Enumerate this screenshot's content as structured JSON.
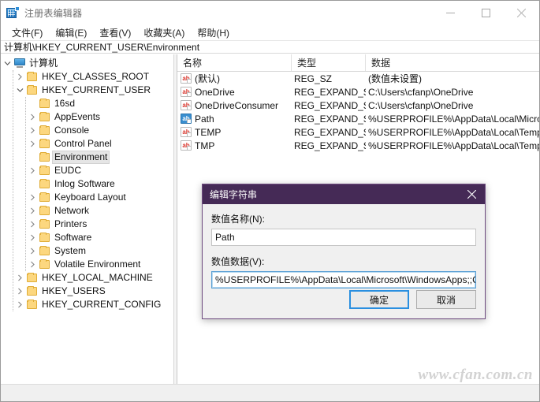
{
  "window": {
    "title": "注册表编辑器",
    "icon": "regedit-icon",
    "minimize_label": "最小化",
    "maximize_label": "最大化",
    "close_label": "关闭"
  },
  "menubar": {
    "items": [
      {
        "label": "文件(F)",
        "name": "menu-file"
      },
      {
        "label": "编辑(E)",
        "name": "menu-edit"
      },
      {
        "label": "查看(V)",
        "name": "menu-view"
      },
      {
        "label": "收藏夹(A)",
        "name": "menu-favorites"
      },
      {
        "label": "帮助(H)",
        "name": "menu-help"
      }
    ]
  },
  "address": {
    "path": "计算机\\HKEY_CURRENT_USER\\Environment"
  },
  "tree": {
    "items": [
      {
        "label": "计算机",
        "depth": 0,
        "chevron": "down",
        "icon": "computer-icon",
        "selected": false
      },
      {
        "label": "HKEY_CLASSES_ROOT",
        "depth": 1,
        "chevron": "right",
        "icon": "folder-icon",
        "selected": false
      },
      {
        "label": "HKEY_CURRENT_USER",
        "depth": 1,
        "chevron": "down",
        "icon": "folder-icon",
        "selected": false
      },
      {
        "label": "16sd",
        "depth": 2,
        "chevron": "none",
        "icon": "folder-icon",
        "selected": false
      },
      {
        "label": "AppEvents",
        "depth": 2,
        "chevron": "right",
        "icon": "folder-icon",
        "selected": false
      },
      {
        "label": "Console",
        "depth": 2,
        "chevron": "right",
        "icon": "folder-icon",
        "selected": false
      },
      {
        "label": "Control Panel",
        "depth": 2,
        "chevron": "right",
        "icon": "folder-icon",
        "selected": false
      },
      {
        "label": "Environment",
        "depth": 2,
        "chevron": "none",
        "icon": "folder-icon",
        "selected": true
      },
      {
        "label": "EUDC",
        "depth": 2,
        "chevron": "right",
        "icon": "folder-icon",
        "selected": false
      },
      {
        "label": "Inlog Software",
        "depth": 2,
        "chevron": "none",
        "icon": "folder-icon",
        "selected": false
      },
      {
        "label": "Keyboard Layout",
        "depth": 2,
        "chevron": "right",
        "icon": "folder-icon",
        "selected": false
      },
      {
        "label": "Network",
        "depth": 2,
        "chevron": "right",
        "icon": "folder-icon",
        "selected": false
      },
      {
        "label": "Printers",
        "depth": 2,
        "chevron": "right",
        "icon": "folder-icon",
        "selected": false
      },
      {
        "label": "Software",
        "depth": 2,
        "chevron": "right",
        "icon": "folder-icon",
        "selected": false
      },
      {
        "label": "System",
        "depth": 2,
        "chevron": "right",
        "icon": "folder-icon",
        "selected": false
      },
      {
        "label": "Volatile Environment",
        "depth": 2,
        "chevron": "right",
        "icon": "folder-icon",
        "selected": false
      },
      {
        "label": "HKEY_LOCAL_MACHINE",
        "depth": 1,
        "chevron": "right",
        "icon": "folder-icon",
        "selected": false
      },
      {
        "label": "HKEY_USERS",
        "depth": 1,
        "chevron": "right",
        "icon": "folder-icon",
        "selected": false
      },
      {
        "label": "HKEY_CURRENT_CONFIG",
        "depth": 1,
        "chevron": "right",
        "icon": "folder-icon",
        "selected": false
      }
    ]
  },
  "listview": {
    "columns": [
      {
        "label": "名称",
        "name": "column-name"
      },
      {
        "label": "类型",
        "name": "column-type"
      },
      {
        "label": "数据",
        "name": "column-data"
      }
    ],
    "rows": [
      {
        "name": "(默认)",
        "type": "REG_SZ",
        "data": "(数值未设置)",
        "icon": "string-value-icon",
        "selected": false
      },
      {
        "name": "OneDrive",
        "type": "REG_EXPAND_SZ",
        "data": "C:\\Users\\cfanp\\OneDrive",
        "icon": "string-value-icon",
        "selected": false
      },
      {
        "name": "OneDriveConsumer",
        "type": "REG_EXPAND_SZ",
        "data": "C:\\Users\\cfanp\\OneDrive",
        "icon": "string-value-icon",
        "selected": false
      },
      {
        "name": "Path",
        "type": "REG_EXPAND_SZ",
        "data": "%USERPROFILE%\\AppData\\Local\\Microsoft\\..",
        "icon": "string-value-icon",
        "selected": true
      },
      {
        "name": "TEMP",
        "type": "REG_EXPAND_SZ",
        "data": "%USERPROFILE%\\AppData\\Local\\Temp",
        "icon": "string-value-icon",
        "selected": false
      },
      {
        "name": "TMP",
        "type": "REG_EXPAND_SZ",
        "data": "%USERPROFILE%\\AppData\\Local\\Temp",
        "icon": "string-value-icon",
        "selected": false
      }
    ],
    "icon_text": "ab"
  },
  "dialog": {
    "title": "编辑字符串",
    "close_label": "✕",
    "name_label": "数值名称(N):",
    "name_value": "Path",
    "data_label": "数值数据(V):",
    "data_value_before_caret": "%USERPROFILE%\\AppData",
    "data_value_after_caret": "\\Local\\Microsoft\\WindowsApps;;C:\\Users\\cf.",
    "ok_label": "确定",
    "cancel_label": "取消"
  },
  "watermark": {
    "text": "www.cfan.com.cn"
  },
  "colors": {
    "dialog_titlebar": "#452a56",
    "selection_blue": "#3a8fd0",
    "focus_blue": "#2a8fe0",
    "folder_yellow": "#fcd77f",
    "value_icon_red": "#d9352c"
  }
}
